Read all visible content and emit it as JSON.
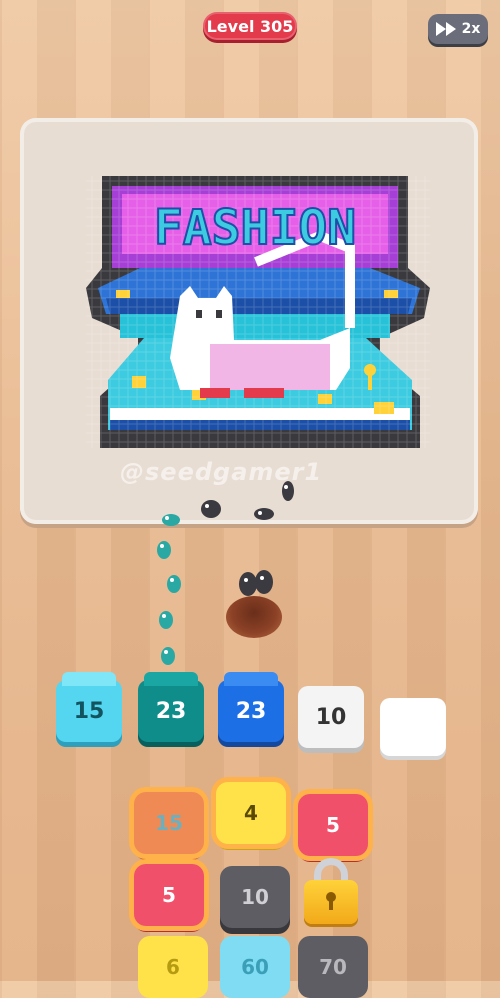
{
  "header": {
    "level_label": "Level 305",
    "speed_label": "2x",
    "speed_icon": "fast-forward-icon"
  },
  "board": {
    "banner_text": "FASHION",
    "watermark": "@seedgamer1"
  },
  "slots": [
    {
      "value": "15",
      "color": "#54d6f0"
    },
    {
      "value": "23",
      "color": "#0e8d8b"
    },
    {
      "value": "23",
      "color": "#1d6fe6"
    },
    {
      "value": "10",
      "color": "#f4f4f4"
    },
    {
      "value": "",
      "color": "#ffffff"
    }
  ],
  "tiles": [
    {
      "value": "15",
      "color": "#f08a55"
    },
    {
      "value": "4",
      "color": "#ffe14a"
    },
    {
      "value": "5",
      "color": "#f0506a"
    },
    {
      "value": "5",
      "color": "#f0506a"
    },
    {
      "value": "10",
      "color": "#5d5d63"
    },
    {
      "value": "6",
      "color": "#ffe14a"
    },
    {
      "value": "60",
      "color": "#7fdcf2"
    },
    {
      "value": "70",
      "color": "#5d5d63"
    }
  ],
  "lock": {
    "icon": "padlock-icon"
  }
}
